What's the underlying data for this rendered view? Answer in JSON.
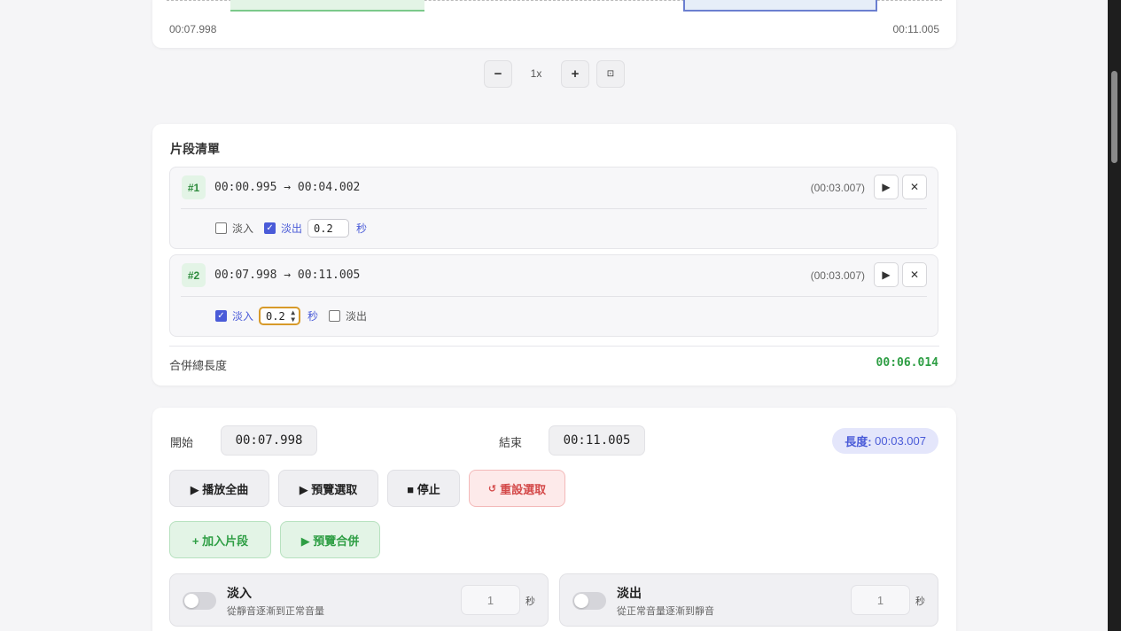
{
  "waveform": {
    "start_time": "00:07.998",
    "end_time": "00:11.005"
  },
  "zoom": {
    "minus_label": "−",
    "level": "1x",
    "plus_label": "+",
    "fit_label": "⊡"
  },
  "segments": {
    "title": "片段清單",
    "items": [
      {
        "badge": "#1",
        "range": "00:00.995 → 00:04.002",
        "duration": "(00:03.007)",
        "fade_in_label": "淡入",
        "fade_in_checked": false,
        "fade_out_label": "淡出",
        "fade_out_checked": true,
        "fade_value": "0.2",
        "unit": "秒"
      },
      {
        "badge": "#2",
        "range": "00:07.998 → 00:11.005",
        "duration": "(00:03.007)",
        "fade_in_label": "淡入",
        "fade_in_checked": true,
        "fade_out_label": "淡出",
        "fade_out_checked": false,
        "fade_value": "0.2",
        "unit": "秒"
      }
    ],
    "play_icon": "▶",
    "remove_icon": "✕",
    "total_label": "合併總長度",
    "total_value": "00:06.014"
  },
  "controls": {
    "start_label": "開始",
    "start_value": "00:07.998",
    "end_label": "結束",
    "end_value": "00:11.005",
    "length_label": "長度:",
    "length_value": "00:03.007",
    "play_all": "▶ 播放全曲",
    "preview_selection": "▶ 預覽選取",
    "stop": "■ 停止",
    "reset_icon": "↺",
    "reset_selection": "重設選取",
    "add_segment": "+ 加入片段",
    "preview_merge": "▶ 預覽合併",
    "fade_in": {
      "title": "淡入",
      "desc": "從靜音逐漸到正常音量",
      "value": "1",
      "unit": "秒"
    },
    "fade_out": {
      "title": "淡出",
      "desc": "從正常音量逐漸到靜音",
      "value": "1",
      "unit": "秒"
    }
  },
  "colors": {
    "accent_blue": "#4a5bd8",
    "accent_green": "#2e9e44",
    "accent_red": "#d44a4a"
  }
}
